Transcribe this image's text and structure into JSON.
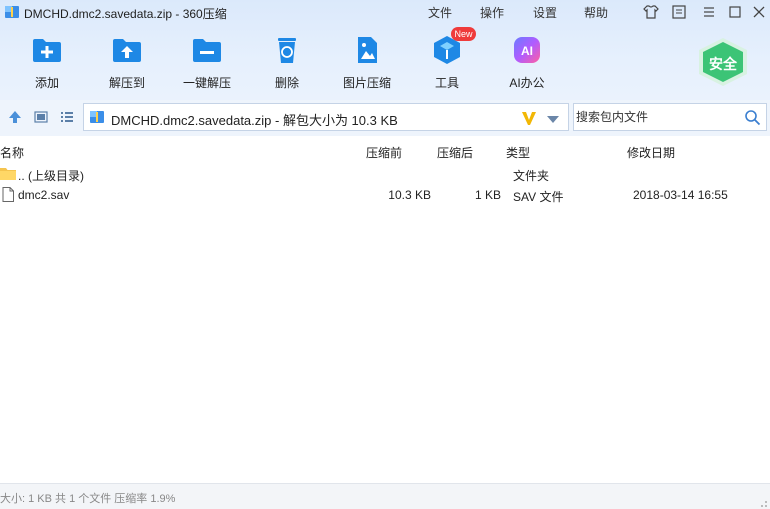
{
  "window": {
    "title": "DMCHD.dmc2.savedata.zip - 360压缩",
    "menu": [
      "文件",
      "操作",
      "设置",
      "帮助"
    ]
  },
  "toolbar": {
    "items": [
      {
        "label": "添加",
        "icon": "add-folder-icon"
      },
      {
        "label": "解压到",
        "icon": "extract-to-icon"
      },
      {
        "label": "一键解压",
        "icon": "one-click-extract-icon"
      },
      {
        "label": "删除",
        "icon": "trash-icon"
      },
      {
        "label": "图片压缩",
        "icon": "image-compress-icon"
      },
      {
        "label": "工具",
        "icon": "tools-icon"
      },
      {
        "label": "AI办公",
        "icon": "ai-office-icon"
      }
    ],
    "new_badge": "New",
    "safe_badge": "安全"
  },
  "address": {
    "path": "DMCHD.dmc2.savedata.zip - 解包大小为 10.3 KB"
  },
  "search": {
    "placeholder": "搜索包内文件"
  },
  "columns": [
    "名称",
    "压缩前",
    "压缩后",
    "类型",
    "修改日期"
  ],
  "rows": [
    {
      "name": ".. (上级目录)",
      "before": "",
      "after": "",
      "type": "文件夹",
      "date": "",
      "icon": "folder-icon"
    },
    {
      "name": "dmc2.sav",
      "before": "10.3 KB",
      "after": "1 KB",
      "type": "SAV 文件",
      "date": "2018-03-14 16:55",
      "icon": "file-icon"
    }
  ],
  "status": "大小: 1 KB 共 1 个文件 压缩率 1.9%",
  "colors": {
    "accent": "#1e88e5",
    "toolbar_bg": "#e3eefc",
    "safe_green": "#3cc476",
    "new_red": "#ef3b3b"
  }
}
